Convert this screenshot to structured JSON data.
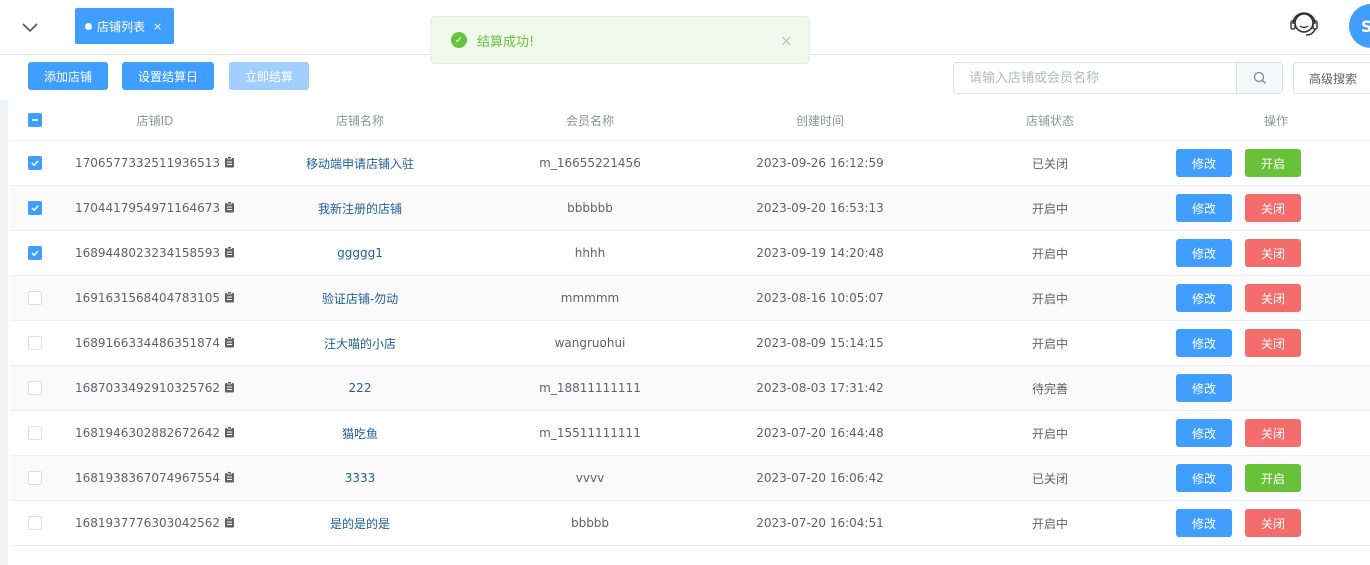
{
  "tabs": [
    {
      "label": "店铺列表",
      "close": "×"
    }
  ],
  "avatar_letter": "S",
  "toast": {
    "message": "结算成功!",
    "close": "×"
  },
  "toolbar": {
    "add_label": "添加店铺",
    "set_settle_day_label": "设置结算日",
    "settle_now_label": "立即结算",
    "advanced_search_label": "高级搜索"
  },
  "search": {
    "placeholder": "请输入店铺或会员名称",
    "value": ""
  },
  "table": {
    "headers": {
      "id": "店铺ID",
      "name": "店铺名称",
      "member": "会员名称",
      "time": "创建时间",
      "status": "店铺状态",
      "op": "操作"
    },
    "rows": [
      {
        "checked": true,
        "id": "1706577332511936513",
        "name": "移动端申请店铺入驻",
        "member": "m_16655221456",
        "time": "2023-09-26 16:12:59",
        "status": "已关闭",
        "edit": "修改",
        "action": "开启",
        "action_type": "open"
      },
      {
        "checked": true,
        "id": "1704417954971164673",
        "name": "我新注册的店铺",
        "member": "bbbbbb",
        "time": "2023-09-20 16:53:13",
        "status": "开启中",
        "edit": "修改",
        "action": "关闭",
        "action_type": "close"
      },
      {
        "checked": true,
        "id": "1689448023234158593",
        "name": "ggggg1",
        "member": "hhhh",
        "time": "2023-09-19 14:20:48",
        "status": "开启中",
        "edit": "修改",
        "action": "关闭",
        "action_type": "close"
      },
      {
        "checked": false,
        "id": "1691631568404783105",
        "name": "验证店铺-勿动",
        "member": "mmmmm",
        "time": "2023-08-16 10:05:07",
        "status": "开启中",
        "edit": "修改",
        "action": "关闭",
        "action_type": "close"
      },
      {
        "checked": false,
        "id": "1689166334486351874",
        "name": "汪大喵的小店",
        "member": "wangruohui",
        "time": "2023-08-09 15:14:15",
        "status": "开启中",
        "edit": "修改",
        "action": "关闭",
        "action_type": "close"
      },
      {
        "checked": false,
        "id": "1687033492910325762",
        "name": "222",
        "member": "m_18811111111",
        "time": "2023-08-03 17:31:42",
        "status": "待完善",
        "edit": "修改",
        "action": "",
        "action_type": "none"
      },
      {
        "checked": false,
        "id": "1681946302882672642",
        "name": "猫吃鱼",
        "member": "m_15511111111",
        "time": "2023-07-20 16:44:48",
        "status": "开启中",
        "edit": "修改",
        "action": "关闭",
        "action_type": "close"
      },
      {
        "checked": false,
        "id": "1681938367074967554",
        "name": "3333",
        "member": "vvvv",
        "time": "2023-07-20 16:06:42",
        "status": "已关闭",
        "edit": "修改",
        "action": "开启",
        "action_type": "open"
      },
      {
        "checked": false,
        "id": "1681937776303042562",
        "name": "是的是的是",
        "member": "bbbbb",
        "time": "2023-07-20 16:04:51",
        "status": "开启中",
        "edit": "修改",
        "action": "关闭",
        "action_type": "close"
      }
    ]
  }
}
